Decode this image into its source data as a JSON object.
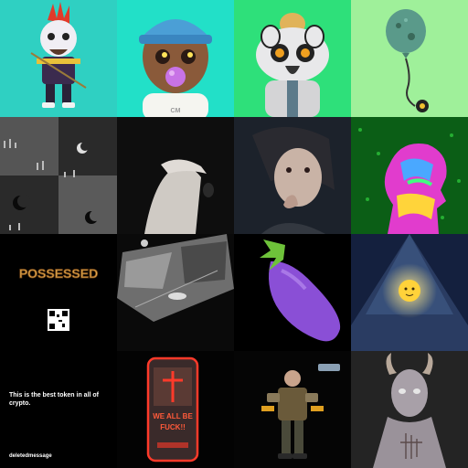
{
  "gallery": {
    "tiles": [
      {
        "name": "punk-character",
        "bg": "#2ed4c4"
      },
      {
        "name": "cartoon-kid-bubblegum",
        "bg": "#22e0c8",
        "beanie_text": "CM"
      },
      {
        "name": "lemur-character",
        "bg": "#2ee07a"
      },
      {
        "name": "balloon",
        "bg": "#9ff09a"
      },
      {
        "name": "crescent-moons-grid",
        "bg": "#2a2a2a"
      },
      {
        "name": "dark-hands-photo",
        "bg": "#101010"
      },
      {
        "name": "portrait-photo",
        "bg": "#1a1f26"
      },
      {
        "name": "psychedelic-silhouette",
        "bg": "#0b5e16"
      },
      {
        "name": "possessed-text-art",
        "bg": "#000000",
        "headline": "POSSESSED"
      },
      {
        "name": "grainy-bw-photo",
        "bg": "#0a0a0a"
      },
      {
        "name": "eggplant-emoji",
        "bg": "#000000"
      },
      {
        "name": "glowing-moon-pyramid",
        "bg": "#1a2244"
      },
      {
        "name": "text-post",
        "bg": "#000000",
        "caption": "This is the best token in all of crypto.",
        "handle": "deletedmessage"
      },
      {
        "name": "neon-can",
        "bg": "#030303",
        "can_text_1": "WE ALL BE",
        "can_text_2": "FUCK!!"
      },
      {
        "name": "armored-soldier",
        "bg": "#050505"
      },
      {
        "name": "horned-demon",
        "bg": "#222222"
      }
    ]
  },
  "colors": {
    "accent_teal": "#2ed4c4",
    "neon_red": "#ff3a2a",
    "moon_yellow": "#ffd23a",
    "eggplant_purple": "#8a4fd6"
  }
}
